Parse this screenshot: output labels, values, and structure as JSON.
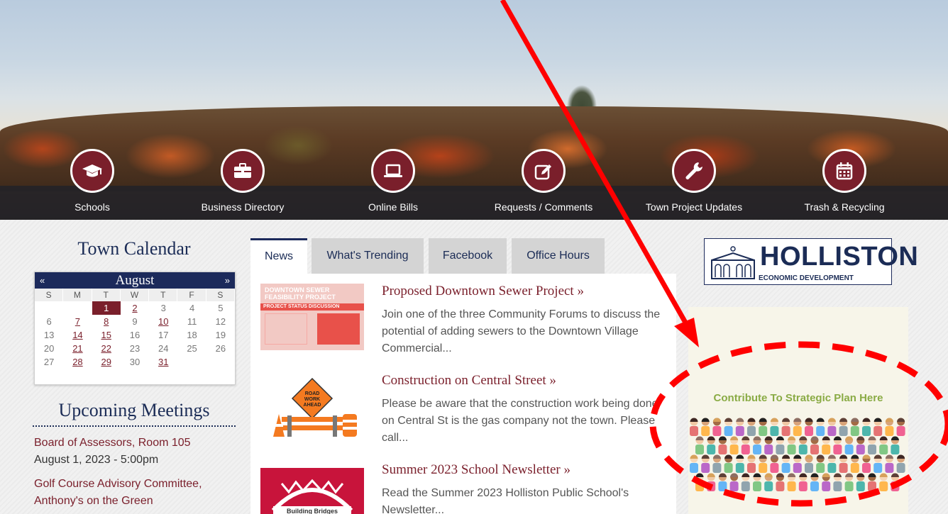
{
  "nav": [
    {
      "label": "Schools",
      "icon": "graduation-cap-icon"
    },
    {
      "label": "Business Directory",
      "icon": "briefcase-icon"
    },
    {
      "label": "Online Bills",
      "icon": "laptop-icon"
    },
    {
      "label": "Requests / Comments",
      "icon": "pencil-square-icon"
    },
    {
      "label": "Town Project Updates",
      "icon": "wrench-icon"
    },
    {
      "label": "Trash & Recycling",
      "icon": "calendar-icon"
    }
  ],
  "calendar": {
    "title": "Town Calendar",
    "prev": "«",
    "next": "»",
    "month": "August",
    "weekdays": [
      "S",
      "M",
      "T",
      "W",
      "T",
      "F",
      "S"
    ],
    "weeks": [
      [
        "",
        "",
        "1",
        "2",
        "3",
        "4",
        "5"
      ],
      [
        "6",
        "7",
        "8",
        "9",
        "10",
        "11",
        "12"
      ],
      [
        "13",
        "14",
        "15",
        "16",
        "17",
        "18",
        "19"
      ],
      [
        "20",
        "21",
        "22",
        "23",
        "24",
        "25",
        "26"
      ],
      [
        "27",
        "28",
        "29",
        "30",
        "31",
        "",
        ""
      ]
    ],
    "linked_days": [
      "1",
      "2",
      "7",
      "8",
      "10",
      "14",
      "15",
      "21",
      "22",
      "28",
      "29",
      "31"
    ],
    "today": "1"
  },
  "meetings": {
    "title": "Upcoming Meetings",
    "items": [
      {
        "name": "Board of Assessors, Room 105",
        "when": "August 1, 2023 - 5:00pm"
      },
      {
        "name": "Golf Course Advisory Committee,",
        "when": "Anthony's on the Green"
      }
    ]
  },
  "tabs": [
    "News",
    "What's Trending",
    "Facebook",
    "Office Hours"
  ],
  "news": [
    {
      "title": "Proposed Downtown Sewer Project »",
      "text": "Join one of the three Community Forums to discuss the potential of adding sewers to the Downtown Village Commercial...",
      "thumb_heading": "DOWNTOWN SEWER FEASIBILITY PROJECT",
      "thumb_sub": "PROJECT STATUS DISCUSSION"
    },
    {
      "title": "Construction on Central Street »",
      "text": "Please be aware that the construction work being done on Central St is the gas company not the town. Please call...",
      "thumb_sign": "ROAD WORK AHEAD"
    },
    {
      "title": "Summer 2023 School Newsletter »",
      "text": "Read the Summer 2023 Holliston Public School's Newsletter...",
      "thumb_sign": "Building Bridges"
    }
  ],
  "sidebar": {
    "logo_title": "HOLLISTON",
    "logo_subtitle": "ECONOMIC DEVELOPMENT",
    "promo_text": "Contribute To Strategic Plan Here"
  },
  "colors": {
    "brand_maroon": "#7a1f2b",
    "brand_navy": "#1c2a5b",
    "annotation_red": "#ff0000",
    "promo_green": "#8aab45"
  }
}
